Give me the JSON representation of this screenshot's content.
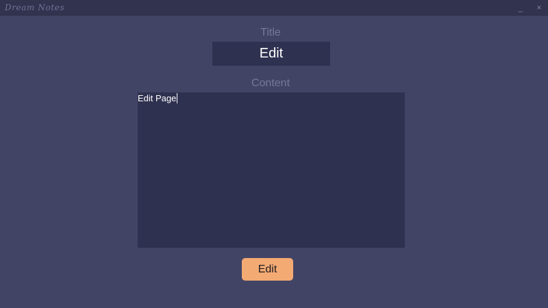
{
  "window": {
    "title": "Dream Notes",
    "minimize_symbol": "_",
    "close_symbol": "×"
  },
  "form": {
    "title_label": "Title",
    "title_value": "Edit",
    "content_label": "Content",
    "content_value": "Edit Page",
    "submit_label": "Edit"
  },
  "colors": {
    "background": "#424466",
    "titlebar": "#31334f",
    "input_background": "#2f3150",
    "label": "#747999",
    "button": "#f4aa73"
  }
}
